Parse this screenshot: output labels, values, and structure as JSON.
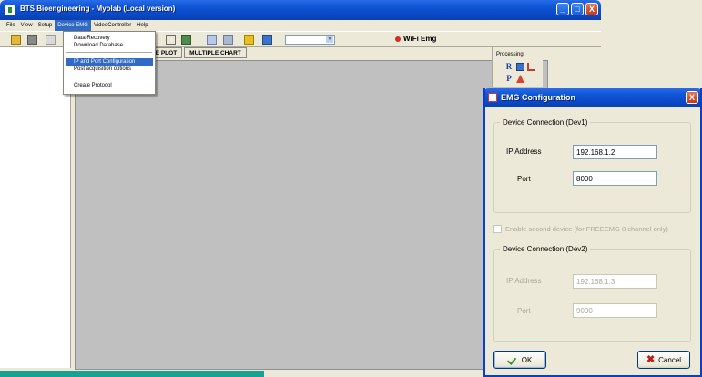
{
  "window": {
    "title": "BTS Bioengineering - Myolab (Local version)",
    "controls": {
      "minimize": "_",
      "maximize": "□",
      "close": "X"
    }
  },
  "menubar": {
    "items": [
      "File",
      "View",
      "Setup",
      "Device EMG",
      "VideoController",
      "Help"
    ],
    "active_index": 3
  },
  "toolbar": {
    "wifi_label": "WiFi Emg",
    "wifi_color": "#d12b2b",
    "dropdown_arrow": "▼"
  },
  "tabs": [
    "UE PLOT",
    "MULTIPLE CHART"
  ],
  "right_panel": {
    "heading": "Processing",
    "tools": [
      "R",
      "P"
    ]
  },
  "device_menu": {
    "items": [
      {
        "label": "Data Recovery",
        "highlighted": false
      },
      {
        "label": "Download Database",
        "highlighted": false
      },
      {
        "label": "IP and Port Configuration",
        "highlighted": true
      },
      {
        "label": "Post acquisition options",
        "highlighted": false
      },
      {
        "label": "Create Protocol",
        "highlighted": false
      }
    ]
  },
  "dialog": {
    "title": "EMG Configuration",
    "close_glyph": "X",
    "dev1": {
      "legend": "Device Connection (Dev1)",
      "ip_label": "IP Address",
      "ip_value": "192.168.1.2",
      "port_label": "Port",
      "port_value": "8000"
    },
    "second_device_checkbox": {
      "label": "Enable second device (for FREEEMG 8 channel only)",
      "checked": false
    },
    "dev2": {
      "legend": "Device Connection (Dev2)",
      "ip_label": "IP Address",
      "ip_value": "192.168.1.3",
      "port_label": "Port",
      "port_value": "9000"
    },
    "ok_label": "OK",
    "cancel_label": "Cancel",
    "cancel_glyph": "✖"
  }
}
